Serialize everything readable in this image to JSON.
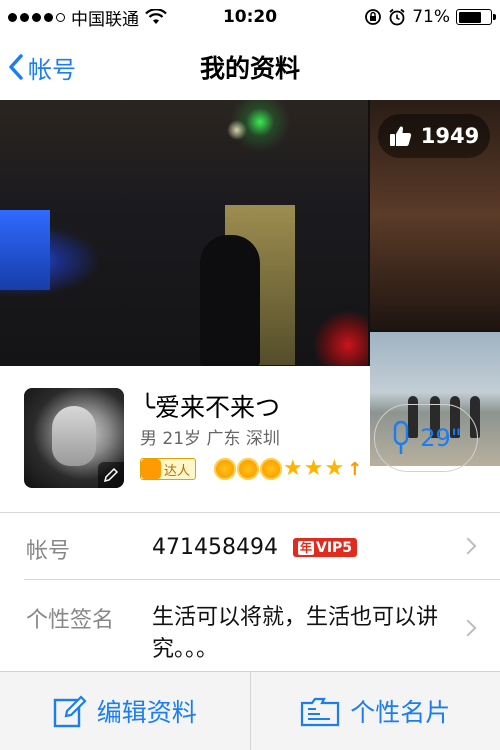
{
  "status_bar": {
    "carrier": "中国联通",
    "time": "10:20",
    "battery_percent": "71%",
    "battery_level": 0.71,
    "signal_bars_filled": 4,
    "icons": [
      "signal-dots-icon",
      "wifi-icon",
      "rotation-lock-icon",
      "alarm-icon",
      "battery-icon"
    ]
  },
  "nav": {
    "back_label": "帐号",
    "title": "我的资料"
  },
  "photos": {
    "like_count": "1949"
  },
  "profile": {
    "nickname": "╰爱来不来つ",
    "basic_info": "男  21岁  广东 深圳",
    "badge_label": "达人",
    "voice_duration": "29\""
  },
  "rows": {
    "account": {
      "label": "帐号",
      "value": "471458494",
      "vip_prefix": "年",
      "vip_label": "VIP5"
    },
    "signature": {
      "label": "个性签名",
      "value": "生活可以将就，生活也可以讲究。。。"
    }
  },
  "bottom_bar": {
    "edit_label": "编辑资料",
    "card_label": "个性名片"
  },
  "colors": {
    "accent": "#1a7ef2",
    "vip_red": "#e02b1e",
    "level_gold": "#ffb400"
  }
}
